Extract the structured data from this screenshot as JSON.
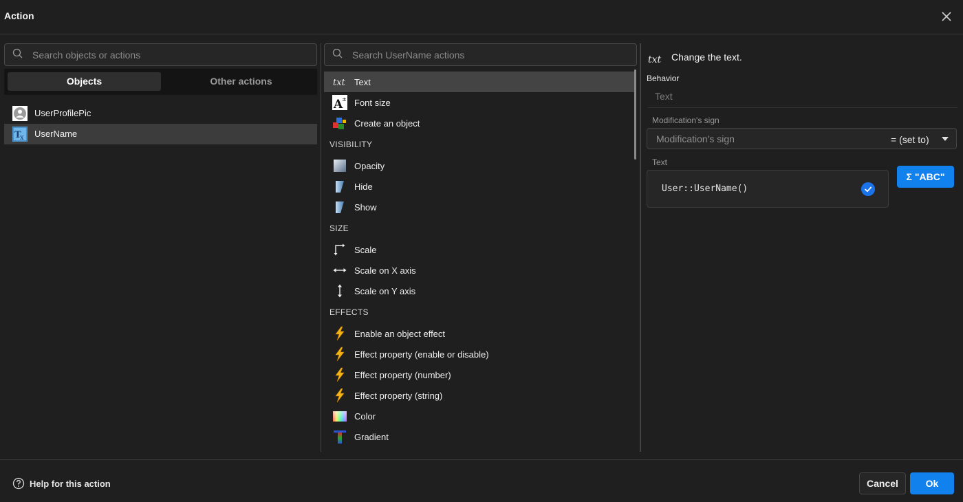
{
  "dialog": {
    "title": "Action",
    "close_icon": "close-icon"
  },
  "left": {
    "search": {
      "placeholder": "Search objects or actions",
      "icon": "search-icon"
    },
    "tabs": [
      {
        "label": "Objects",
        "active": true
      },
      {
        "label": "Other actions",
        "active": false
      }
    ],
    "objects": [
      {
        "label": "UserProfilePic",
        "icon": "sprite-avatar-icon",
        "selected": false
      },
      {
        "label": "UserName",
        "icon": "text-object-icon",
        "selected": true
      }
    ]
  },
  "middle": {
    "search": {
      "placeholder": "Search UserName actions",
      "icon": "search-icon"
    },
    "actions_top": [
      {
        "label": "Text",
        "icon": "txt-icon",
        "selected": true
      },
      {
        "label": "Font size",
        "icon": "font-size-icon"
      },
      {
        "label": "Create an object",
        "icon": "create-object-icon"
      }
    ],
    "sections": {
      "visibility": {
        "title": "VISIBILITY",
        "items": [
          {
            "label": "Opacity",
            "icon": "opacity-icon"
          },
          {
            "label": "Hide",
            "icon": "hide-icon"
          },
          {
            "label": "Show",
            "icon": "show-icon"
          }
        ]
      },
      "size": {
        "title": "SIZE",
        "items": [
          {
            "label": "Scale",
            "icon": "scale-icon"
          },
          {
            "label": "Scale on X axis",
            "icon": "scale-x-icon"
          },
          {
            "label": "Scale on Y axis",
            "icon": "scale-y-icon"
          }
        ]
      },
      "effects": {
        "title": "EFFECTS",
        "items": [
          {
            "label": "Enable an object effect",
            "icon": "lightning-icon"
          },
          {
            "label": "Effect property (enable or disable)",
            "icon": "lightning-icon"
          },
          {
            "label": "Effect property (number)",
            "icon": "lightning-icon"
          },
          {
            "label": "Effect property (string)",
            "icon": "lightning-icon"
          },
          {
            "label": "Color",
            "icon": "color-icon"
          },
          {
            "label": "Gradient",
            "icon": "gradient-icon"
          }
        ]
      }
    }
  },
  "right": {
    "header_icon_text": "txt",
    "header": "Change the text.",
    "behavior_label": "Behavior",
    "behavior_value": "Text",
    "modification_label": "Modification's sign",
    "modification_placeholder": "Modification's sign",
    "modification_value": "= (set to)",
    "text_label": "Text",
    "text_value": "User::UserName()",
    "expression_button": "\"ABC\"",
    "sigma": "Σ",
    "colors": {
      "accent": "#1181ee",
      "check": "#1a73e8"
    }
  },
  "footer": {
    "help_label": "Help for this action",
    "cancel_label": "Cancel",
    "ok_label": "Ok"
  }
}
